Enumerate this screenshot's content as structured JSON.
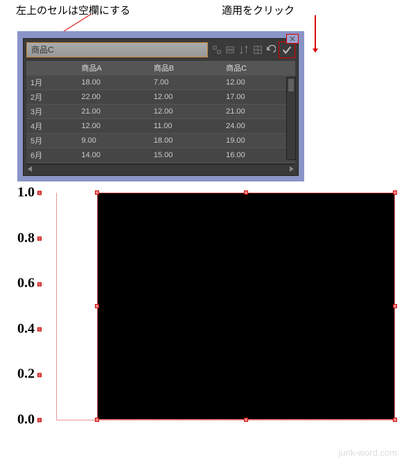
{
  "annotations": {
    "left_note": "左上のセルは空欄にする",
    "right_note": "適用をクリック"
  },
  "panel": {
    "input_value": "商品C",
    "toolbar": {
      "flip_h": "flip-h",
      "flip_v": "flip-v",
      "swap": "swap",
      "fit": "fit",
      "undo": "undo",
      "apply": "apply"
    },
    "headers": [
      "",
      "商品A",
      "商品B",
      "商品C"
    ],
    "rows": [
      {
        "label": "1月",
        "a": "18.00",
        "b": "7.00",
        "c": "12.00"
      },
      {
        "label": "2月",
        "a": "22.00",
        "b": "12.00",
        "c": "17.00"
      },
      {
        "label": "3月",
        "a": "21.00",
        "b": "12.00",
        "c": "21.00"
      },
      {
        "label": "4月",
        "a": "12.00",
        "b": "11.00",
        "c": "24.00"
      },
      {
        "label": "5月",
        "a": "9.00",
        "b": "18.00",
        "c": "19.00"
      },
      {
        "label": "6月",
        "a": "14.00",
        "b": "15.00",
        "c": "16.00"
      }
    ]
  },
  "chart_data": {
    "type": "bar",
    "categories": [],
    "values": [],
    "title": "",
    "xlabel": "",
    "ylabel": "",
    "ylim": [
      0.0,
      1.0
    ],
    "yticks": [
      0.0,
      0.2,
      0.4,
      0.6,
      0.8,
      1.0
    ],
    "ytick_labels": [
      "0.0",
      "0.2",
      "0.4",
      "0.6",
      "0.8",
      "1.0"
    ]
  },
  "watermark": "junk-word.com"
}
